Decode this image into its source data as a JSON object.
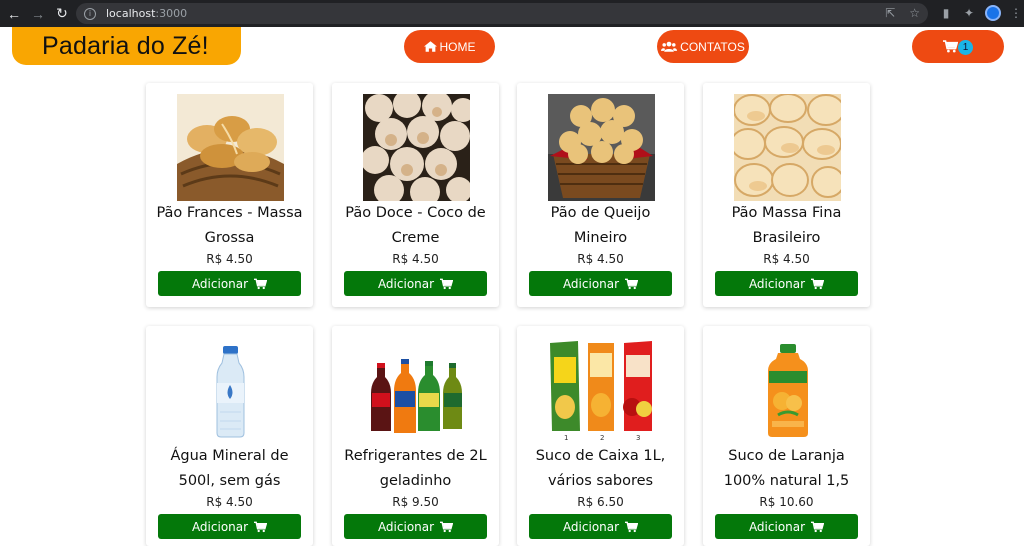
{
  "browser": {
    "url_host": "localhost",
    "url_port": ":3000"
  },
  "header": {
    "brand": "Padaria do Zé!",
    "nav": [
      {
        "label": "HOME",
        "icon": "home-icon"
      },
      {
        "label": "CONTATOS",
        "icon": "users-icon"
      }
    ],
    "cart": {
      "icon": "cart-icon",
      "count": "1"
    }
  },
  "colors": {
    "brand_bg": "#f9a602",
    "nav_pill": "#ee4a12",
    "add_button": "#04780a",
    "badge": "#1ab5e6"
  },
  "products": [
    {
      "name": "Pão Frances - Massa Grossa",
      "price": "R$ 4.50",
      "button": "Adicionar",
      "image": "french-bread-basket"
    },
    {
      "name": "Pão Doce - Coco de Creme",
      "price": "R$ 4.50",
      "button": "Adicionar",
      "image": "coconut-sweet-bread"
    },
    {
      "name": "Pão de Queijo Mineiro",
      "price": "R$ 4.50",
      "button": "Adicionar",
      "image": "cheese-bread-basket"
    },
    {
      "name": "Pão Massa Fina Brasileiro",
      "price": "R$ 4.50",
      "button": "Adicionar",
      "image": "soft-rolls"
    },
    {
      "name": "Água Mineral de 500l, sem gás",
      "price": "R$ 4.50",
      "button": "Adicionar",
      "image": "water-bottle"
    },
    {
      "name": "Refrigerantes de 2L geladinho",
      "price": "R$ 9.50",
      "button": "Adicionar",
      "image": "soda-bottles"
    },
    {
      "name": "Suco de Caixa 1L, vários sabores",
      "price": "R$ 6.50",
      "button": "Adicionar",
      "image": "juice-boxes"
    },
    {
      "name": "Suco de Laranja 100% natural 1,5",
      "price": "R$ 10.60",
      "button": "Adicionar",
      "image": "orange-juice-bottle"
    }
  ],
  "image_labels": {
    "juice_numbers": [
      "1",
      "2",
      "3"
    ]
  }
}
